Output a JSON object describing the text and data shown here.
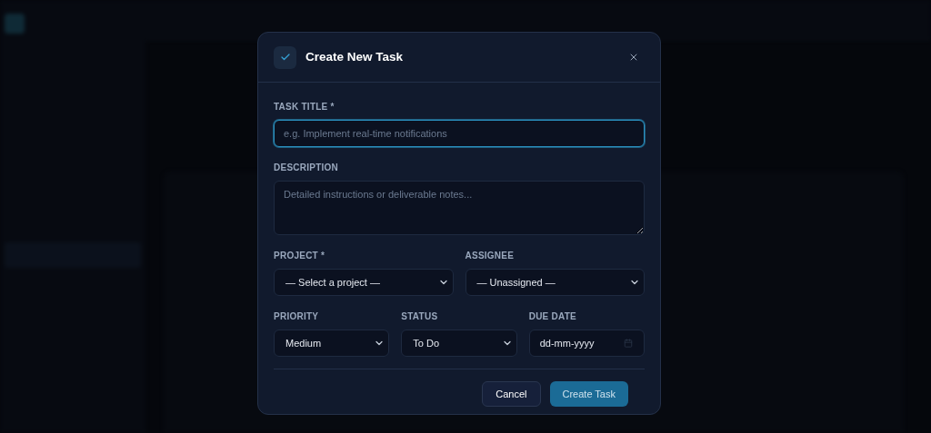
{
  "dialog": {
    "title": "Create New Task",
    "task_title": {
      "label": "TASK TITLE *",
      "kind": "text",
      "placeholder": "e.g. Implement real-time notifications",
      "focused": true
    },
    "description": {
      "label": "DESCRIPTION",
      "kind": "textarea",
      "placeholder": "Detailed instructions or deliverable notes...",
      "focused": false
    },
    "project": {
      "label": "PROJECT *",
      "kind": "select",
      "value": "— Select a project —",
      "focused": false
    },
    "assignee": {
      "label": "ASSIGNEE",
      "kind": "select",
      "value": "— Unassigned —",
      "focused": false
    },
    "priority": {
      "label": "PRIORITY",
      "kind": "select",
      "value": "Medium",
      "focused": false
    },
    "status": {
      "label": "STATUS",
      "kind": "select",
      "value": "To Do",
      "focused": false
    },
    "due_date": {
      "label": "DUE DATE",
      "kind": "date",
      "value": "dd-mm-yyyy",
      "focused": false
    },
    "buttons": [
      {
        "label": "Cancel",
        "kind": "secondary"
      },
      {
        "label": "Create Task",
        "kind": "primary"
      }
    ]
  }
}
